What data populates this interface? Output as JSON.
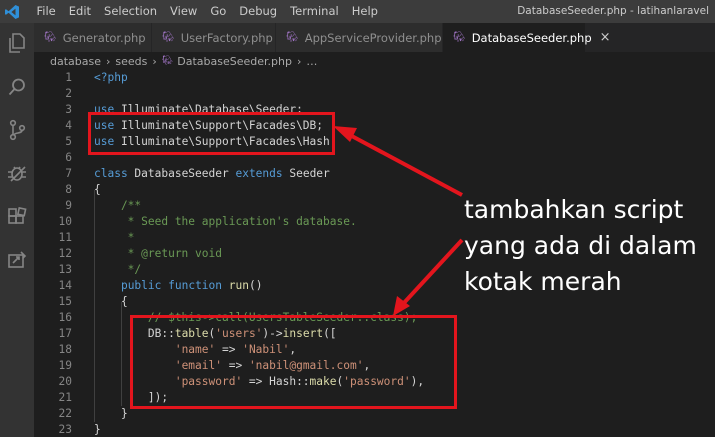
{
  "menu": [
    "File",
    "Edit",
    "Selection",
    "View",
    "Go",
    "Debug",
    "Terminal",
    "Help"
  ],
  "window_title": "DatabaseSeeder.php - latihanlaravel",
  "tabs": [
    {
      "label": "Generator.php",
      "active": false
    },
    {
      "label": "UserFactory.php",
      "active": false
    },
    {
      "label": "AppServiceProvider.php",
      "active": false
    },
    {
      "label": "DatabaseSeeder.php",
      "active": true
    }
  ],
  "breadcrumb": [
    "database",
    "seeds",
    "DatabaseSeeder.php",
    "…"
  ],
  "lines": [
    {
      "n": "1",
      "tokens": [
        {
          "t": "<?php",
          "c": "kw"
        }
      ]
    },
    {
      "n": "2",
      "tokens": []
    },
    {
      "n": "3",
      "tokens": [
        {
          "t": "use",
          "c": "kw"
        },
        {
          "t": " Illuminate\\Database\\Seeder;",
          "c": "txt"
        }
      ]
    },
    {
      "n": "4",
      "tokens": [
        {
          "t": "use",
          "c": "kw"
        },
        {
          "t": " Illuminate\\Support\\Facades\\DB;",
          "c": "txt"
        }
      ]
    },
    {
      "n": "5",
      "tokens": [
        {
          "t": "use",
          "c": "kw"
        },
        {
          "t": " Illuminate\\Support\\Facades\\Hash;",
          "c": "txt"
        }
      ]
    },
    {
      "n": "6",
      "tokens": []
    },
    {
      "n": "7",
      "tokens": [
        {
          "t": "class",
          "c": "kw"
        },
        {
          "t": " DatabaseSeeder ",
          "c": "txt"
        },
        {
          "t": "extends",
          "c": "kw"
        },
        {
          "t": " Seeder",
          "c": "txt"
        }
      ]
    },
    {
      "n": "8",
      "tokens": [
        {
          "t": "{",
          "c": "txt"
        }
      ]
    },
    {
      "n": "9",
      "tokens": [
        {
          "t": "    /**",
          "c": "cmt"
        }
      ]
    },
    {
      "n": "10",
      "tokens": [
        {
          "t": "     * Seed the application's database.",
          "c": "cmt"
        }
      ]
    },
    {
      "n": "11",
      "tokens": [
        {
          "t": "     *",
          "c": "cmt"
        }
      ]
    },
    {
      "n": "12",
      "tokens": [
        {
          "t": "     * @return void",
          "c": "cmt"
        }
      ]
    },
    {
      "n": "13",
      "tokens": [
        {
          "t": "     */",
          "c": "cmt"
        }
      ]
    },
    {
      "n": "14",
      "tokens": [
        {
          "t": "    ",
          "c": "txt"
        },
        {
          "t": "public",
          "c": "kw"
        },
        {
          "t": " ",
          "c": "txt"
        },
        {
          "t": "function",
          "c": "kw"
        },
        {
          "t": " ",
          "c": "txt"
        },
        {
          "t": "run",
          "c": "fn"
        },
        {
          "t": "()",
          "c": "txt"
        }
      ]
    },
    {
      "n": "15",
      "tokens": [
        {
          "t": "    {",
          "c": "txt"
        }
      ]
    },
    {
      "n": "16",
      "tokens": [
        {
          "t": "        // $this->call(UsersTableSeeder::class);",
          "c": "cmt"
        }
      ]
    },
    {
      "n": "17",
      "tokens": [
        {
          "t": "        DB::",
          "c": "txt"
        },
        {
          "t": "table",
          "c": "fn"
        },
        {
          "t": "(",
          "c": "txt"
        },
        {
          "t": "'users'",
          "c": "str"
        },
        {
          "t": ")->",
          "c": "txt"
        },
        {
          "t": "insert",
          "c": "fn"
        },
        {
          "t": "([",
          "c": "txt"
        }
      ]
    },
    {
      "n": "18",
      "tokens": [
        {
          "t": "            ",
          "c": "txt"
        },
        {
          "t": "'name'",
          "c": "str"
        },
        {
          "t": " => ",
          "c": "txt"
        },
        {
          "t": "'Nabil'",
          "c": "str"
        },
        {
          "t": ",",
          "c": "txt"
        }
      ]
    },
    {
      "n": "19",
      "tokens": [
        {
          "t": "            ",
          "c": "txt"
        },
        {
          "t": "'email'",
          "c": "str"
        },
        {
          "t": " => ",
          "c": "txt"
        },
        {
          "t": "'nabil@gmail.com'",
          "c": "str"
        },
        {
          "t": ",",
          "c": "txt"
        }
      ]
    },
    {
      "n": "20",
      "tokens": [
        {
          "t": "            ",
          "c": "txt"
        },
        {
          "t": "'password'",
          "c": "str"
        },
        {
          "t": " => Hash::",
          "c": "txt"
        },
        {
          "t": "make",
          "c": "fn"
        },
        {
          "t": "(",
          "c": "txt"
        },
        {
          "t": "'password'",
          "c": "str"
        },
        {
          "t": "),",
          "c": "txt"
        }
      ]
    },
    {
      "n": "21",
      "tokens": [
        {
          "t": "        ]);",
          "c": "txt"
        }
      ]
    },
    {
      "n": "22",
      "tokens": [
        {
          "t": "    }",
          "c": "txt"
        }
      ]
    },
    {
      "n": "23",
      "tokens": [
        {
          "t": "}",
          "c": "txt"
        }
      ]
    }
  ],
  "annotation": {
    "lines": [
      "tambahkan script",
      "yang ada di dalam",
      "kotak merah"
    ]
  },
  "colors": {
    "highlight_red": "#e3151d",
    "keyword": "#569cd6",
    "function": "#dcdcaa",
    "string": "#ce9178",
    "comment": "#6a9955",
    "text": "#d4d4d4",
    "php_icon": "#a074c4"
  },
  "icons": [
    "vscode-logo",
    "files-icon",
    "search-icon",
    "source-control-icon",
    "debug-icon",
    "extensions-icon",
    "remote-icon",
    "php-icon",
    "close-icon"
  ]
}
